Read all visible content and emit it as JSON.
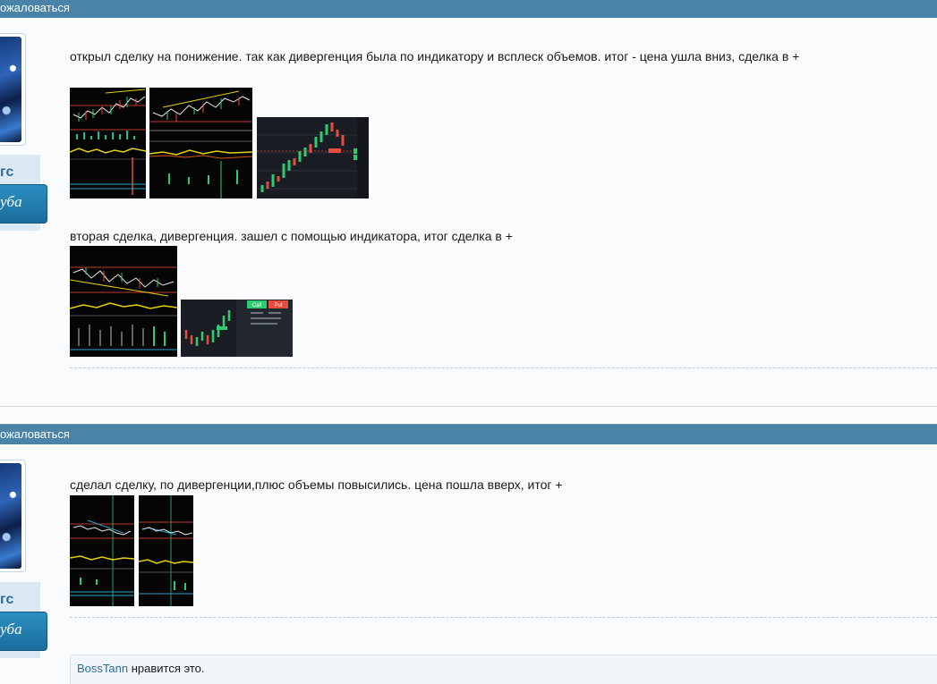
{
  "posts": [
    {
      "report_label": "ожаловаться",
      "username": "гс",
      "rank": "уба",
      "paragraphs": [
        "открыл сделку на понижение. так как дивергенция была по индикатору и всплеск объемов. итог - цена ушла вниз, сделка в +",
        "вторая сделка, дивергенция. зашел с помощью индикатора, итог сделка в +"
      ],
      "screenshot_buttons": {
        "call": "Call",
        "put": "Put"
      }
    },
    {
      "report_label": "ожаловаться",
      "username": "гс",
      "rank": "уба",
      "paragraphs": [
        "сделал сделку, по дивергенции,плюс объемы повысились. цена пошла вверх, итог +"
      ],
      "likes": {
        "user": "BossTann",
        "text": " нравится это."
      }
    }
  ],
  "colors": {
    "post_bar": "#4a83a8",
    "username": "#2e6c9a",
    "rank_badge": "#2b8ec1",
    "candle_up": "#2ecc71",
    "candle_down": "#e74c3c",
    "indicator": "#e6d200"
  }
}
